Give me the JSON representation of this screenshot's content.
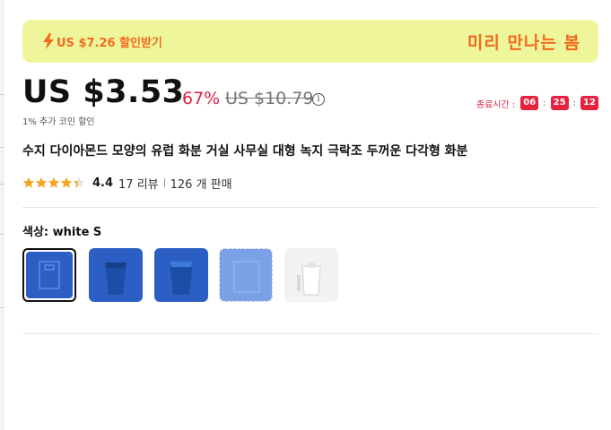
{
  "promo": {
    "coupon": "US $7.26 할인받기",
    "slogan": "미리 만나는 봄"
  },
  "price": {
    "current": "US $3.53",
    "discount": "67%",
    "original": "US $10.79",
    "info_glyph": "i",
    "coin_note": "1% 추가 코인 할인"
  },
  "timer": {
    "label": "종료시간 :",
    "hours": "06",
    "minutes": "25",
    "seconds": "12",
    "separator": ":"
  },
  "product": {
    "title": "수지 다이아몬드 모양의 유럽 화분 거실 사무실 대형 녹지 극락조 두꺼운 다각형 화분"
  },
  "rating": {
    "score": "4.4",
    "stars": 4.4,
    "reviews": "17 리뷰",
    "sold": "126 개 판매"
  },
  "variant": {
    "label": "색상: white S",
    "swatches": [
      {
        "name": "swatch-1",
        "color": "#2c5fc4",
        "selected": true
      },
      {
        "name": "swatch-2",
        "color": "#2c5fc4",
        "selected": false
      },
      {
        "name": "swatch-3",
        "color": "#2c5fc4",
        "selected": false
      },
      {
        "name": "swatch-4",
        "color": "#7aa0e6",
        "selected": false
      },
      {
        "name": "swatch-5",
        "color": "#f2f2f2",
        "selected": false
      }
    ]
  },
  "colors": {
    "promo_bg": "#eef59a",
    "promo_text": "#f36a1f",
    "sale_red": "#e02144",
    "timer_box": "#e6233f",
    "star": "#f5a623"
  }
}
